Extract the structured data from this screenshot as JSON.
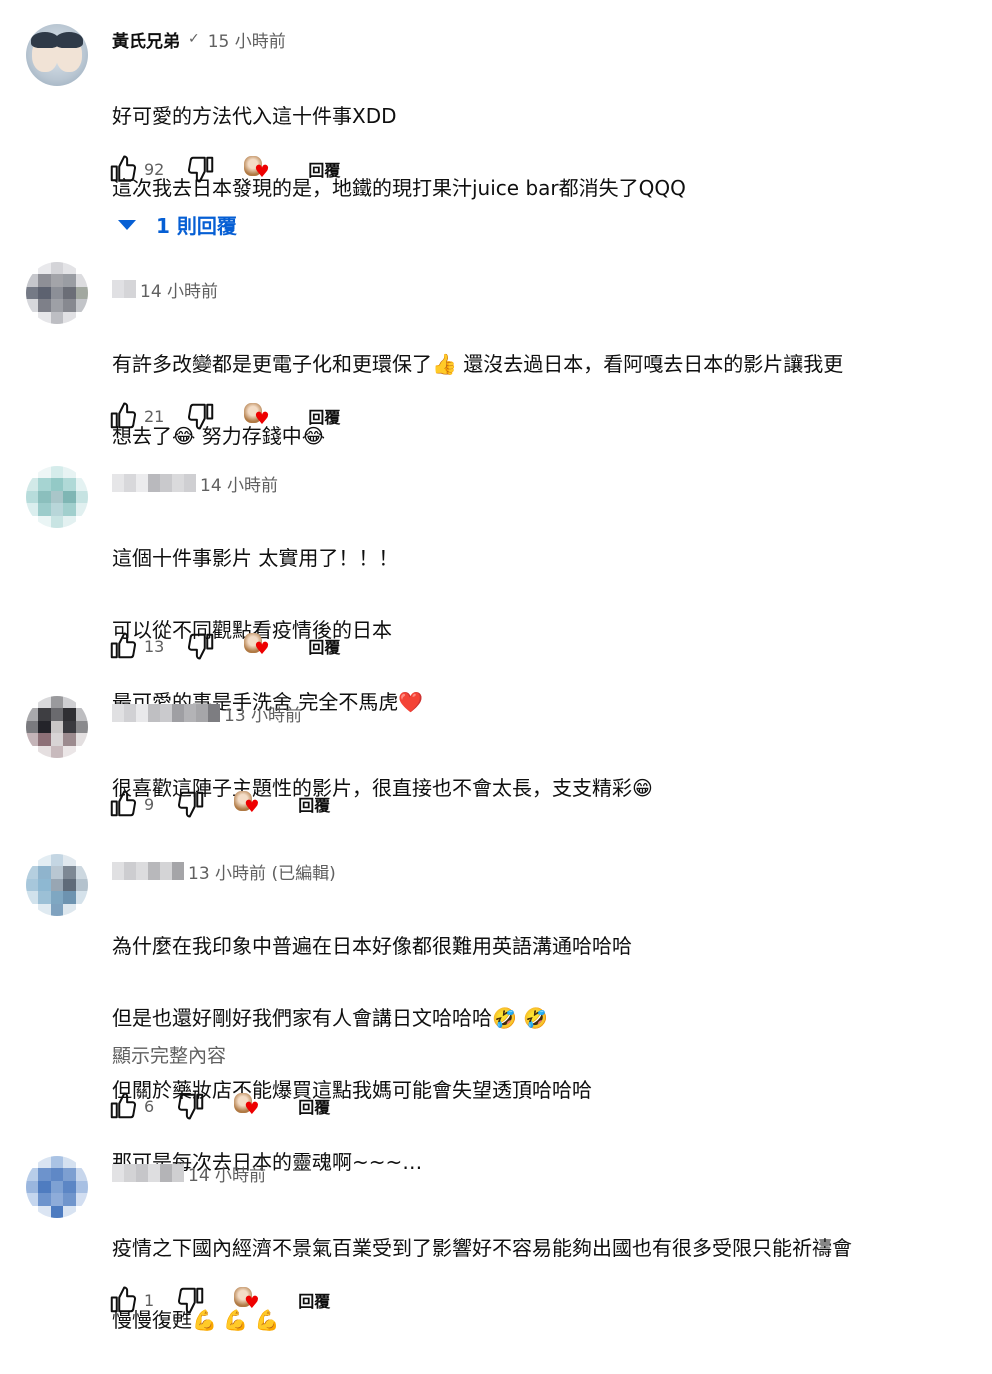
{
  "colors": {
    "text": "#0f0f0f",
    "secondary": "#606060",
    "link": "#065fd4",
    "heart": "#ee0000"
  },
  "icons": {
    "like": "thumbs-up-icon",
    "dislike": "thumbs-down-icon",
    "creator_heart": "creator-heart-icon",
    "verified": "check-icon",
    "expand": "caret-down-icon"
  },
  "comments": [
    {
      "author": "黃氏兄弟",
      "verified_mark": "✓",
      "time": "15 小時前",
      "lines": [
        "好可愛的方法代入這十件事XDD",
        "這次我去日本發現的是，地鐵的現打果汁juice bar都消失了QQQ"
      ],
      "likes": "92",
      "reply_label": "回覆",
      "replies_label": "1 則回覆"
    },
    {
      "time": "14 小時前",
      "lines": [
        "有許多改變都是更電子化和更環保了👍 還沒去過日本，看阿嘎去日本的影片讓我更",
        "想去了😂 努力存錢中😂"
      ],
      "likes": "21",
      "reply_label": "回覆"
    },
    {
      "time": "14 小時前",
      "lines": [
        "這個十件事影片 太實用了！！！",
        "可以從不同觀點看疫情後的日本",
        "最可愛的事是手洗舍 完全不馬虎❤️"
      ],
      "likes": "13",
      "reply_label": "回覆"
    },
    {
      "time": "13 小時前",
      "lines": [
        "很喜歡這陣子主題性的影片，很直接也不會太長，支支精彩😁"
      ],
      "likes": "9",
      "reply_label": "回覆"
    },
    {
      "time": "13 小時前 (已編輯)",
      "lines": [
        "為什麼在我印象中普遍在日本好像都很難用英語溝通哈哈哈",
        "但是也還好剛好我們家有人會講日文哈哈哈🤣 🤣",
        "但關於藥妝店不能爆買這點我媽可能會失望透頂哈哈哈",
        "那可是每次去日本的靈魂啊~~~…"
      ],
      "more_label": "顯示完整內容",
      "likes": "6",
      "reply_label": "回覆"
    },
    {
      "time": "14 小時前",
      "lines": [
        "疫情之下國內經濟不景氣百業受到了影響好不容易能夠出國也有很多受限只能祈禱會",
        "慢慢復甦💪 💪 💪"
      ],
      "likes": "1",
      "reply_label": "回覆"
    }
  ]
}
